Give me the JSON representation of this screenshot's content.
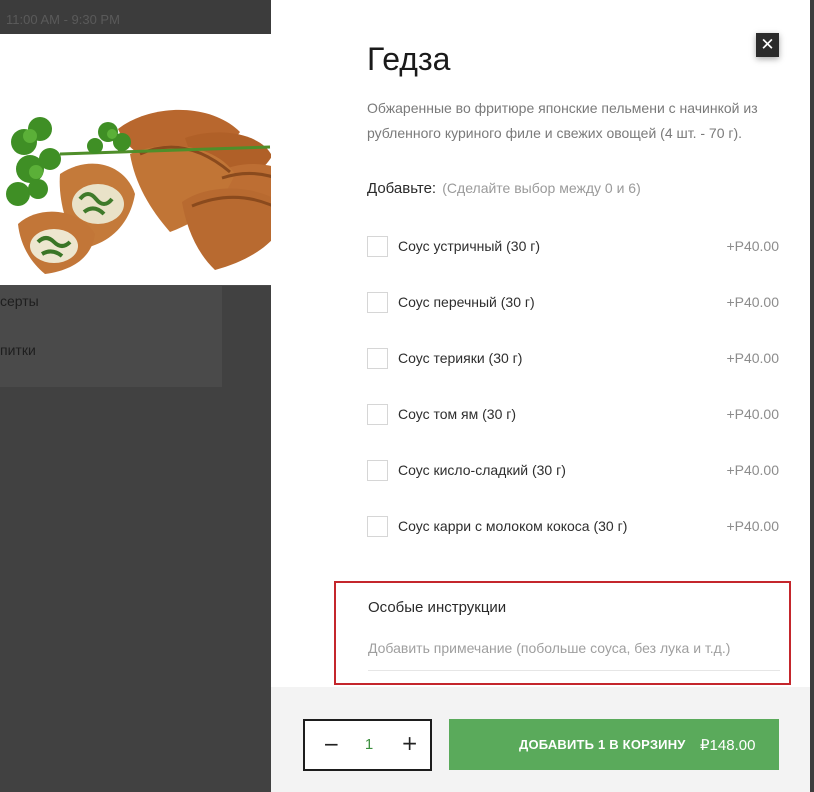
{
  "background": {
    "hours": "11:00 AM - 9:30 PM",
    "menu_items": [
      "серты",
      "питки"
    ]
  },
  "product": {
    "title": "Гедза",
    "description": "Обжаренные во фритюре японские пельмени с начинкой из рубленного куриного филе и свежих овощей (4 шт. - 70 г).",
    "image_alt": "gyoza-photo"
  },
  "close_icon": "✕",
  "addons": {
    "label": "Добавьте:",
    "hint": "(Сделайте выбор между 0 и 6)",
    "options": [
      {
        "label": "Соус устричный (30 г)",
        "price": "+Р40.00",
        "checked": false
      },
      {
        "label": "Соус перечный (30 г)",
        "price": "+Р40.00",
        "checked": false
      },
      {
        "label": "Соус терияки (30 г)",
        "price": "+Р40.00",
        "checked": false
      },
      {
        "label": "Соус том ям (30 г)",
        "price": "+Р40.00",
        "checked": false
      },
      {
        "label": "Соус кисло-сладкий (30 г)",
        "price": "+Р40.00",
        "checked": false
      },
      {
        "label": "Соус карри с молоком кокоса (30 г)",
        "price": "+Р40.00",
        "checked": false
      }
    ]
  },
  "instructions": {
    "title": "Особые инструкции",
    "placeholder": "Добавить примечание (побольше соуса, без лука и т.д.)",
    "value": ""
  },
  "footer": {
    "quantity": "1",
    "minus": "−",
    "plus": "+",
    "add_label": "ДОБАВИТЬ 1 В КОРЗИНУ",
    "total": "₽148.00"
  },
  "colors": {
    "accent_green": "#5aaa5b",
    "quantity_green": "#3d8f3f",
    "highlight_red": "#c4262c"
  }
}
